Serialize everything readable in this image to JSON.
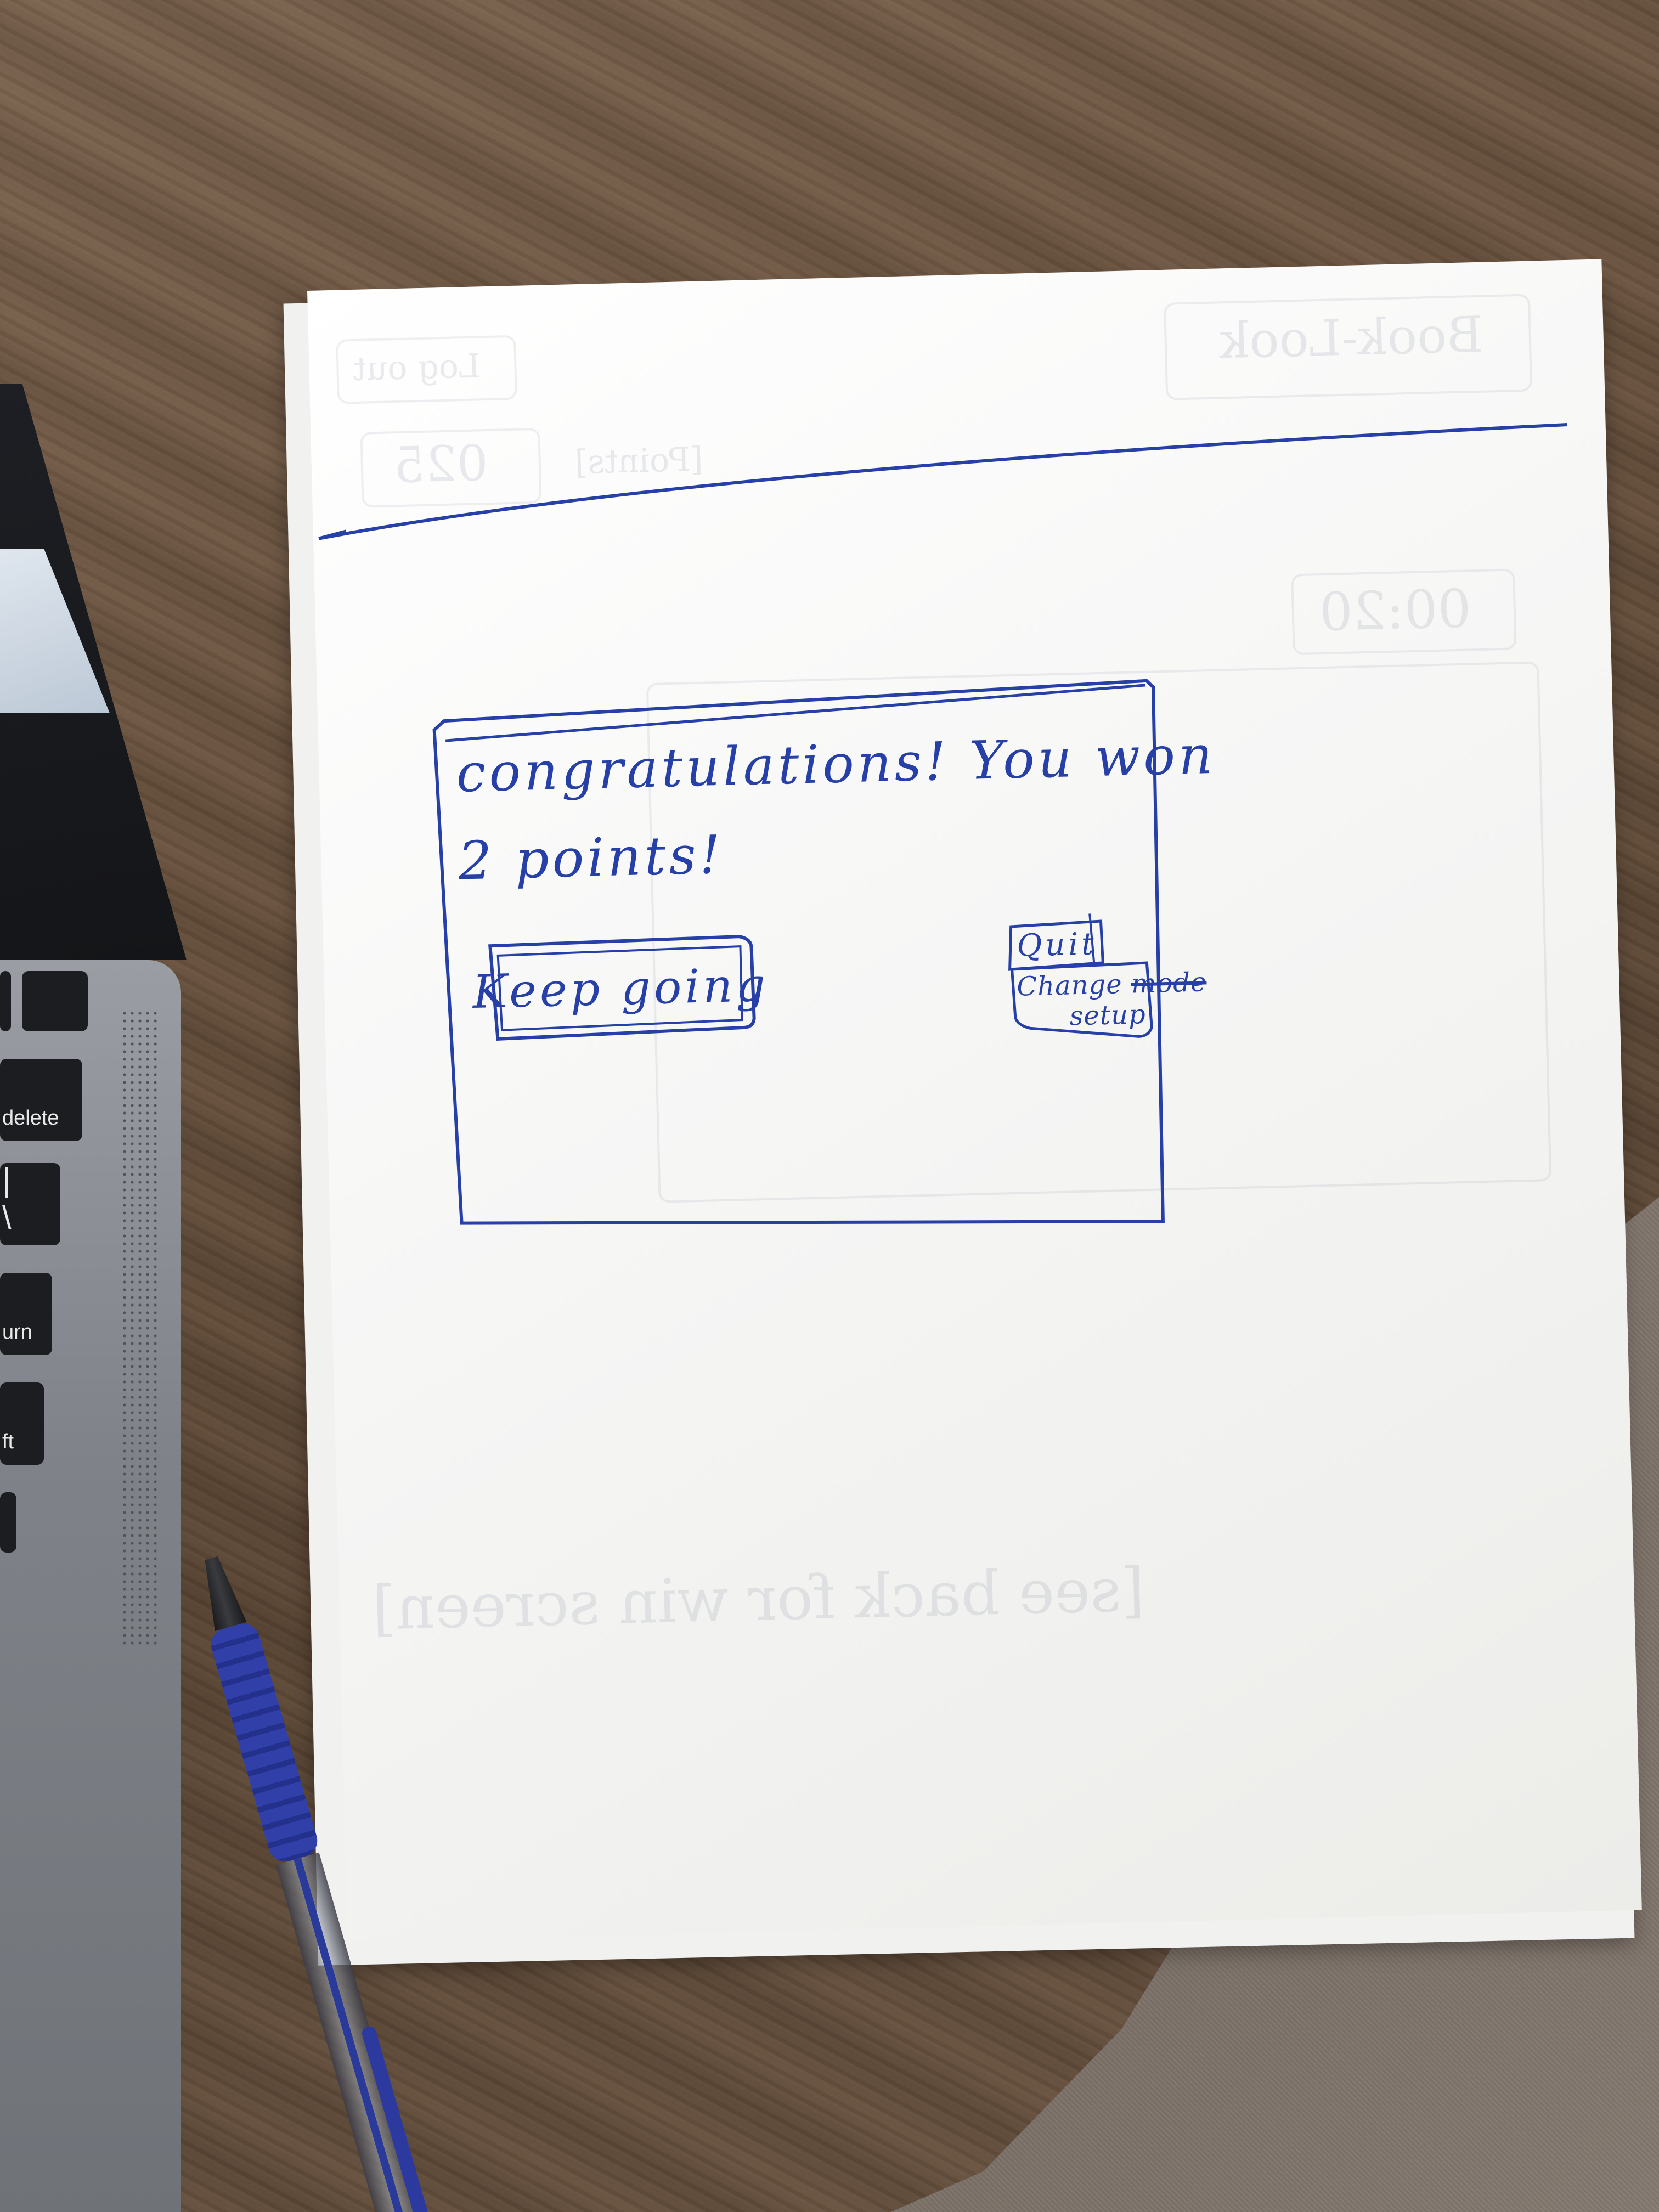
{
  "dialog": {
    "message_line1": "congratulations! You won",
    "message_line2": "2 points!",
    "keep_going_label": "Keep going",
    "quit_label": "Quit",
    "change_setup_line1": "Change",
    "change_setup_crossed": "mode",
    "change_setup_line2": "setup"
  },
  "background_sketch": {
    "timer": "00:20",
    "book_look": "Book-Look",
    "log_out": "Log out",
    "points_value": "025",
    "points_label": "[Points]",
    "see_back": "[see back for win screen]"
  },
  "laptop": {
    "key_delete": "delete",
    "key_return": "urn",
    "key_shift": "ft"
  },
  "colors": {
    "ink": "#2740a8",
    "paper": "#ffffff",
    "wood": "#6b5440"
  }
}
